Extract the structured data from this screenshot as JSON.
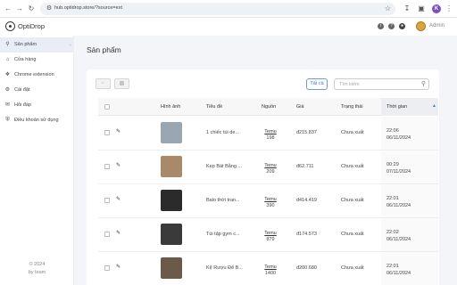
{
  "browser": {
    "url": "hub.optidrop.store/?source=ext",
    "profile_initial": "K"
  },
  "app": {
    "name": "OptiDrop",
    "user": "Admin"
  },
  "sidebar": {
    "items": [
      {
        "label": "Sản phẩm",
        "icon": "search-icon",
        "active": true
      },
      {
        "label": "Cửa hàng",
        "icon": "store-icon",
        "active": false
      },
      {
        "label": "Chrome extension",
        "icon": "extension-icon",
        "active": false
      },
      {
        "label": "Cài đặt",
        "icon": "gear-icon",
        "active": false
      },
      {
        "label": "Hỏi đáp",
        "icon": "chat-icon",
        "active": false
      },
      {
        "label": "Điều khoản sử dụng",
        "icon": "shield-icon",
        "active": false
      }
    ],
    "footer_year": "© 2024",
    "footer_by": "by team"
  },
  "page": {
    "title": "Sản phẩm",
    "filter_label": "Tất cả",
    "search_placeholder": "Tìm kiếm"
  },
  "table": {
    "headers": [
      "Hình ảnh",
      "Tiêu đề",
      "Nguồn",
      "Giá",
      "Trạng thái",
      "Thời gian"
    ],
    "rows": [
      {
        "title": "1 chiếc túi de...",
        "source": "Temu",
        "source_id": "198",
        "price": "đ215.837",
        "status": "Chưa xuất",
        "time": "22:06",
        "date": "06/11/2024",
        "thumb_color": "#9aa6b2"
      },
      {
        "title": "Kẹp Bát Bằng ...",
        "source": "Temu",
        "source_id": "209",
        "price": "đ62.711",
        "status": "Chưa xuất",
        "time": "00:29",
        "date": "07/11/2024",
        "thumb_color": "#a88a6a"
      },
      {
        "title": "Balo thời tran...",
        "source": "Temu",
        "source_id": "390",
        "price": "đ414.419",
        "status": "Chưa xuất",
        "time": "22:01",
        "date": "06/11/2024",
        "thumb_color": "#2b2b2b"
      },
      {
        "title": "Túi tập gym c...",
        "source": "Temu",
        "source_id": "879",
        "price": "đ174.573",
        "status": "Chưa xuất",
        "time": "22:02",
        "date": "06/11/2024",
        "thumb_color": "#3a3a3a"
      },
      {
        "title": "Kệ Rượu Để B...",
        "source": "Temu",
        "source_id": "1400",
        "price": "đ200.680",
        "status": "Chưa xuất",
        "time": "22:01",
        "date": "06/11/2024",
        "thumb_color": "#6b5a4a"
      }
    ]
  }
}
